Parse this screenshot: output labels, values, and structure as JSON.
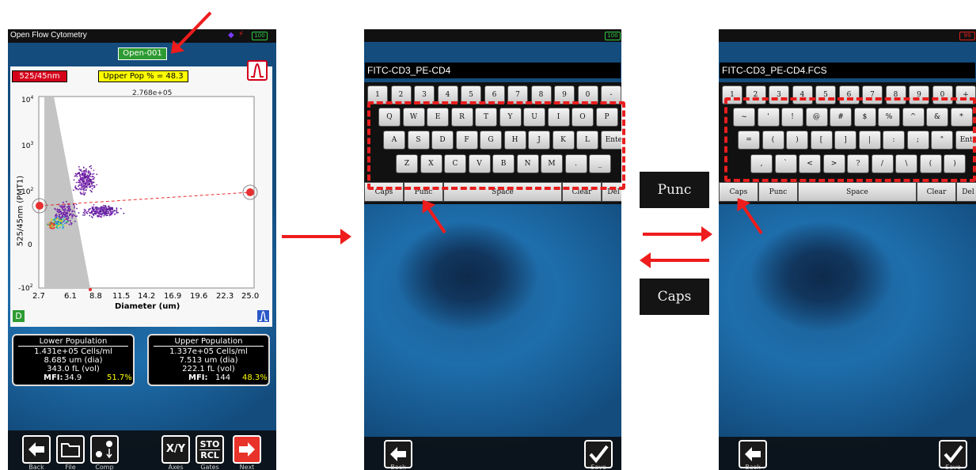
{
  "panel1": {
    "app_title": "Open Flow Cytometry",
    "battery": "100",
    "sample_label": "Open-001",
    "channel_badge": "525/45nm",
    "upper_pop_label": "Upper Pop % = 48.3",
    "axis_top_value": "2.768e+05",
    "ylabel": "525/45nm (PMT1)",
    "xlabel": "Diameter (um)",
    "x_ticks": [
      "2.7",
      "6.1",
      "8.8",
      "11.5",
      "14.2",
      "16.9",
      "19.6",
      "22.3",
      "25.0"
    ],
    "y_ticks": [
      {
        "b": "10",
        "e": "4"
      },
      {
        "b": "10",
        "e": "3"
      },
      {
        "b": "10",
        "e": "2"
      },
      {
        "b": "0",
        "e": ""
      },
      {
        "b": "-10",
        "e": "2"
      }
    ],
    "d_badge": "D",
    "lower": {
      "title": "Lower Population",
      "cells": "1.431e+05 Cells/ml",
      "dia": "8.685 um (dia)",
      "vol": "343.0 fL (vol)",
      "mfi_label": "MFI:",
      "mfi": "34.9",
      "pct": "51.7%"
    },
    "upper": {
      "title": "Upper Population",
      "cells": "1.337e+05 Cells/ml",
      "dia": "7.513 um (dia)",
      "vol": "222.1 fL (vol)",
      "mfi_label": "MFI:",
      "mfi": "144",
      "pct": "48.3%"
    },
    "buttons": {
      "back": "Back",
      "file": "File",
      "comp": "Comp",
      "axes": "Axes",
      "axes_icon": "X/Y",
      "gates": "Gates",
      "gates_icon_top": "STO",
      "gates_icon_bottom": "RCL",
      "next": "Next"
    }
  },
  "panel2": {
    "battery": "100",
    "filename": "FITC-CD3_PE-CD4",
    "number_row": [
      "1",
      "2",
      "3",
      "4",
      "5",
      "6",
      "7",
      "8",
      "9",
      "0",
      "-"
    ],
    "row1": [
      "Q",
      "W",
      "E",
      "R",
      "T",
      "Y",
      "U",
      "I",
      "O",
      "P"
    ],
    "row2": [
      "A",
      "S",
      "D",
      "F",
      "G",
      "H",
      "J",
      "K",
      "L",
      "Enter"
    ],
    "row3": [
      "Z",
      "X",
      "C",
      "V",
      "B",
      "N",
      "M",
      ".",
      "_"
    ],
    "func": {
      "caps": "Caps",
      "punc": "Punc",
      "space": "Space",
      "clear": "Clear",
      "del": "Del"
    },
    "back": "Back",
    "save": "Save"
  },
  "panel3": {
    "battery": "99",
    "filename": "FITC-CD3_PE-CD4.FCS",
    "number_row": [
      "1",
      "2",
      "3",
      "4",
      "5",
      "6",
      "7",
      "8",
      "9",
      "0",
      "+"
    ],
    "row1": [
      "~",
      "'",
      "!",
      "@",
      "#",
      "$",
      "%",
      "^",
      "&",
      "*"
    ],
    "row2": [
      "=",
      "(",
      ")",
      "[",
      "]",
      "|",
      ":",
      ";",
      "\"",
      "Enter"
    ],
    "row3": [
      ",",
      "`",
      "<",
      ">",
      "?",
      "/",
      "\\",
      "(",
      ")"
    ],
    "func": {
      "caps": "Caps",
      "punc": "Punc",
      "space": "Space",
      "clear": "Clear",
      "del": "Del"
    },
    "back": "Back",
    "save": "Save"
  },
  "labels": {
    "punc": "Punc",
    "caps": "Caps"
  },
  "colors": {
    "accent_red": "#ee1c1c",
    "battery_green": "#2ecc40",
    "battery_red": "#e02020",
    "highlight_yellow": "#ffff00",
    "badge_green": "#2e9b32"
  }
}
